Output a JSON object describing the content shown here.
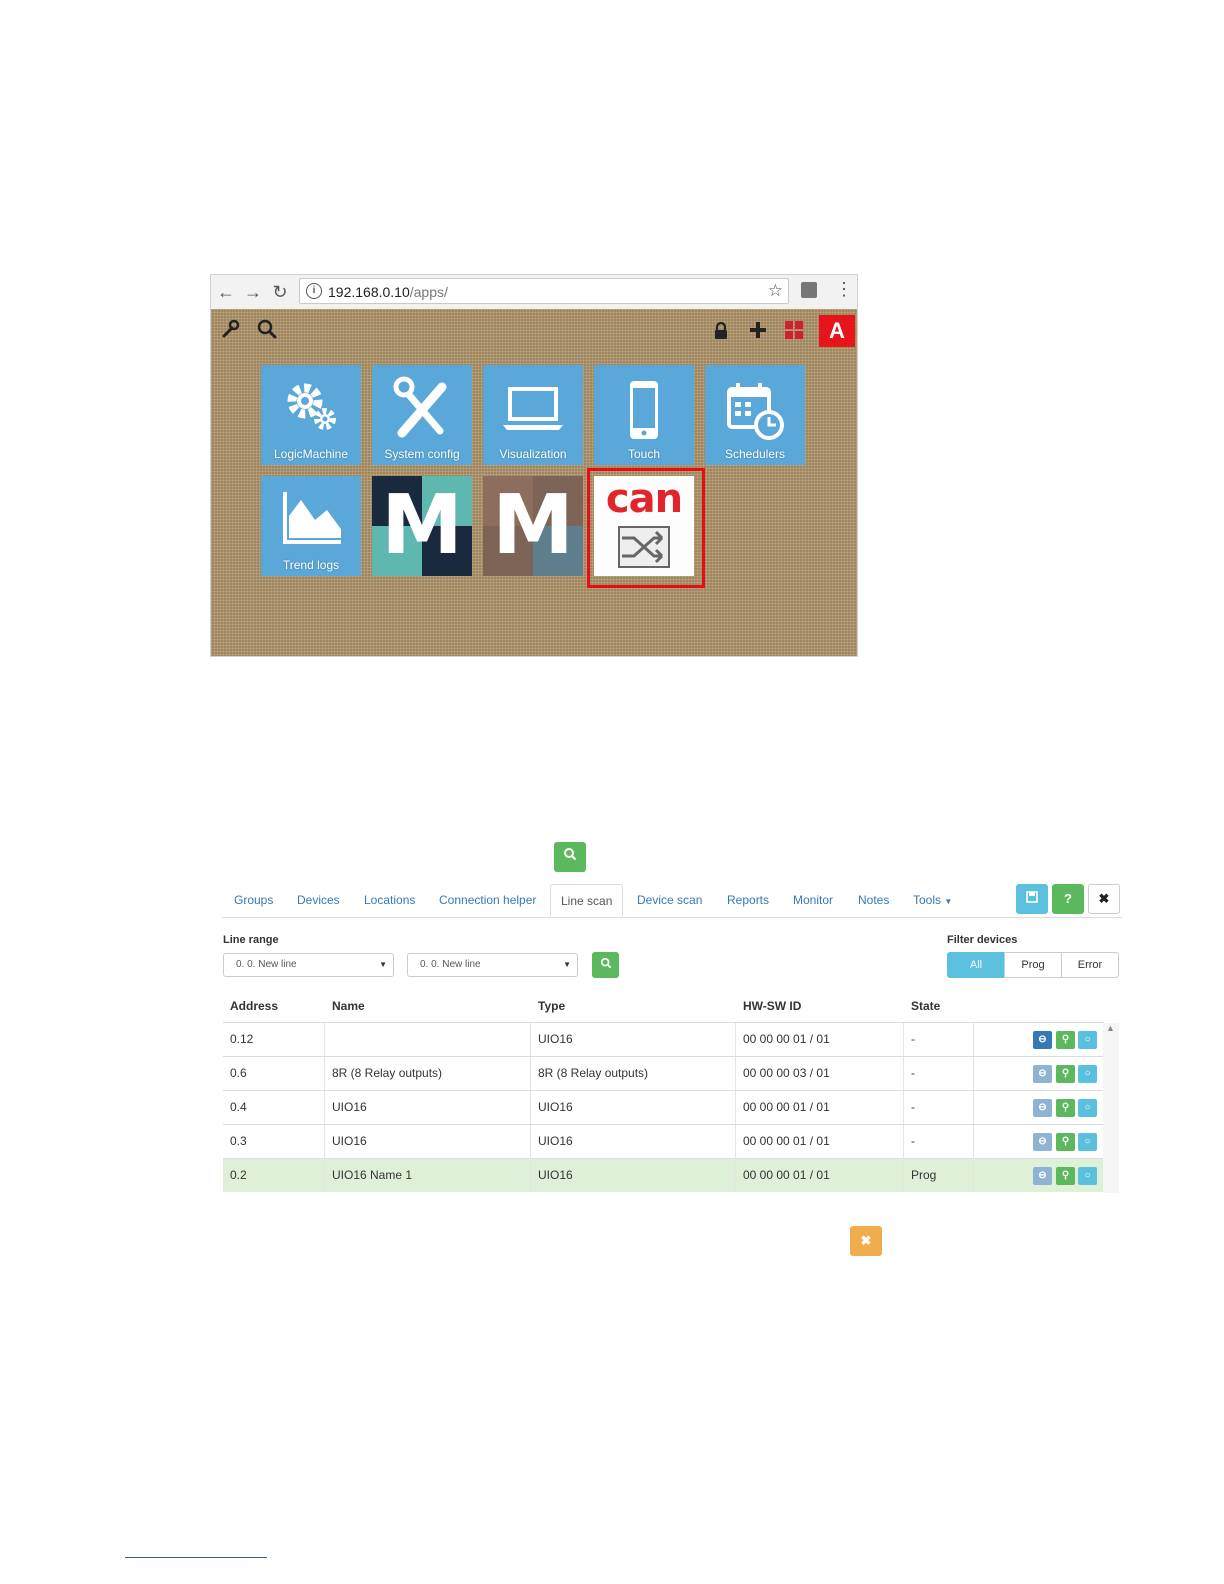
{
  "browser": {
    "address": {
      "host": "192.168.0.10",
      "path": "/apps/"
    },
    "apps": [
      {
        "label": "LogicMachine",
        "icon": "gears-icon"
      },
      {
        "label": "System config",
        "icon": "tools-icon"
      },
      {
        "label": "Visualization",
        "icon": "laptop-icon"
      },
      {
        "label": "Touch",
        "icon": "phone-icon"
      },
      {
        "label": "Schedulers",
        "icon": "calendar-clock-icon"
      },
      {
        "label": "Trend logs",
        "icon": "area-chart-icon"
      },
      {
        "label": "M",
        "icon": "m-logo-dark"
      },
      {
        "label": "M",
        "icon": "m-logo-brown"
      },
      {
        "label": "can",
        "icon": "can-logo"
      }
    ],
    "avatar": "A"
  },
  "panel": {
    "tabs": [
      "Groups",
      "Devices",
      "Locations",
      "Connection helper",
      "Line scan",
      "Device scan",
      "Reports",
      "Monitor",
      "Notes",
      "Tools"
    ],
    "active_tab": "Line scan",
    "line_range_label": "Line range",
    "line_from": "0. 0. New line",
    "line_to": "0. 0. New line",
    "filter_label": "Filter devices",
    "filters": [
      "All",
      "Prog",
      "Error"
    ],
    "columns": [
      "Address",
      "Name",
      "Type",
      "HW-SW ID",
      "State"
    ],
    "rows": [
      {
        "address": "0.12",
        "name": "",
        "type": "UIO16",
        "hwsw": "00 00 00 01 / 01",
        "state": "-"
      },
      {
        "address": "0.6",
        "name": "8R (8 Relay outputs)",
        "type": "8R (8 Relay outputs)",
        "hwsw": "00 00 00 03 / 01",
        "state": "-"
      },
      {
        "address": "0.4",
        "name": "UIO16",
        "type": "UIO16",
        "hwsw": "00 00 00 01 / 01",
        "state": "-"
      },
      {
        "address": "0.3",
        "name": "UIO16",
        "type": "UIO16",
        "hwsw": "00 00 00 01 / 01",
        "state": "-"
      },
      {
        "address": "0.2",
        "name": "UIO16 Name 1",
        "type": "UIO16",
        "hwsw": "00 00 00 01 / 01",
        "state": "Prog"
      }
    ]
  },
  "colors": {
    "tile": "#5aa8d9",
    "green": "#5cb85c",
    "info": "#5bc0de",
    "warning": "#f0ad4e",
    "primary": "#337ab7",
    "highlight": "#e60d14"
  }
}
